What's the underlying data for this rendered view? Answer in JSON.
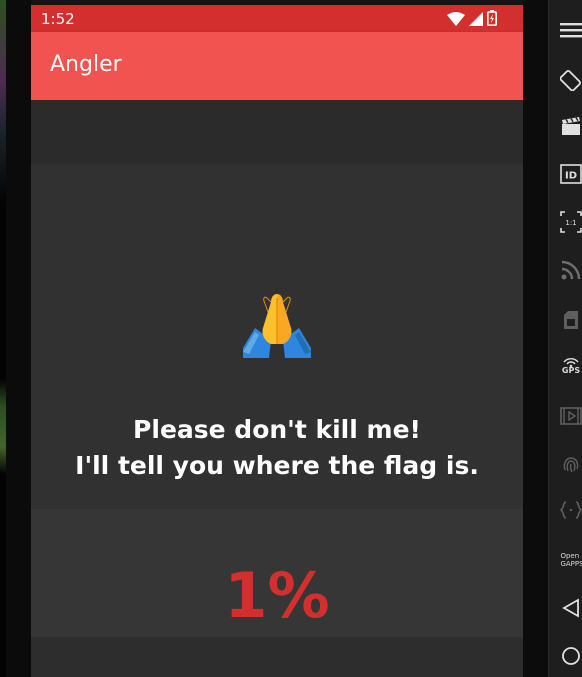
{
  "status_bar": {
    "time": "1:52",
    "icons": [
      "wifi-icon",
      "signal-icon",
      "battery-icon"
    ],
    "color": "#d32f2f"
  },
  "app_bar": {
    "title": "Angler",
    "color": "#f05350"
  },
  "main": {
    "emoji": "folded-hands-emoji",
    "message_line1": "Please don't kill me!",
    "message_line2": "I'll tell you where the flag is.",
    "progress_text": "1%",
    "progress_color": "#d32f2f"
  },
  "emulator_toolbar": {
    "items": [
      {
        "icon": "menu-icon"
      },
      {
        "icon": "rotate-icon"
      },
      {
        "icon": "media-icon"
      },
      {
        "icon": "id-icon",
        "label": "ID"
      },
      {
        "icon": "pixel-perfect-icon",
        "label": "1:1"
      },
      {
        "icon": "network-icon"
      },
      {
        "icon": "sim-icon"
      },
      {
        "icon": "gps-icon",
        "label": "GPS"
      },
      {
        "icon": "screen-record-icon"
      },
      {
        "icon": "fingerprint-icon"
      },
      {
        "icon": "code-icon"
      },
      {
        "icon": "open-gapps-icon",
        "label": "Open GAPPS"
      },
      {
        "icon": "back-nav-icon"
      },
      {
        "icon": "home-nav-icon"
      }
    ]
  }
}
